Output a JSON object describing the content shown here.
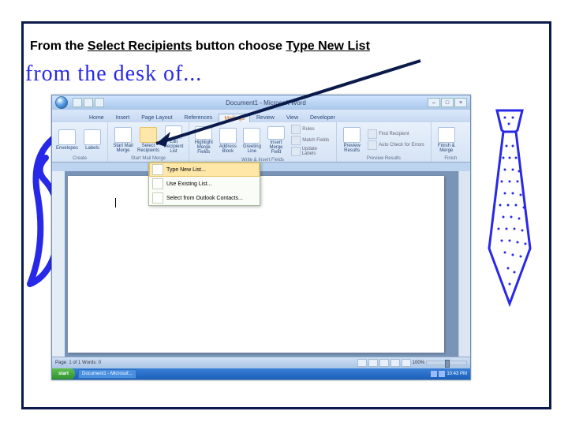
{
  "instruction": {
    "t1": "From the ",
    "t2": "Select Recipients",
    "t3": " button choose ",
    "t4": "Type New List"
  },
  "desk_of": "from the desk of...",
  "word": {
    "title_center": "Document1 - Microsoft Word",
    "tabs": [
      "Home",
      "Insert",
      "Page Layout",
      "References",
      "Mailings",
      "Review",
      "View",
      "Developer"
    ],
    "active_tab": "Mailings",
    "groups": {
      "create": {
        "label": "Create",
        "envelopes": "Envelopes",
        "labels": "Labels"
      },
      "start": {
        "label": "Start Mail Merge",
        "start_mail": "Start Mail\nMerge",
        "select_recip": "Select\nRecipients",
        "edit_recip": "Edit\nRecipient List"
      },
      "write": {
        "label": "Write & Insert Fields",
        "highlight": "Highlight\nMerge Fields",
        "address": "Address\nBlock",
        "greeting": "Greeting\nLine",
        "insert": "Insert Merge\nField",
        "rules": "Rules",
        "match": "Match Fields",
        "update": "Update Labels"
      },
      "preview": {
        "label": "Preview Results",
        "preview": "Preview\nResults",
        "find": "Find Recipient",
        "auto": "Auto Check for Errors"
      },
      "finish": {
        "label": "Finish",
        "finish": "Finish &\nMerge"
      }
    },
    "dropdown": {
      "item1": "Type New List...",
      "item2": "Use Existing List...",
      "item3": "Select from Outlook Contacts..."
    },
    "status_left": "Page: 1 of 1   Words: 0",
    "zoom_pct": "100%"
  },
  "taskbar": {
    "start": "start",
    "app1": "Document1 - Microsof...",
    "time": "10:43 PM"
  }
}
